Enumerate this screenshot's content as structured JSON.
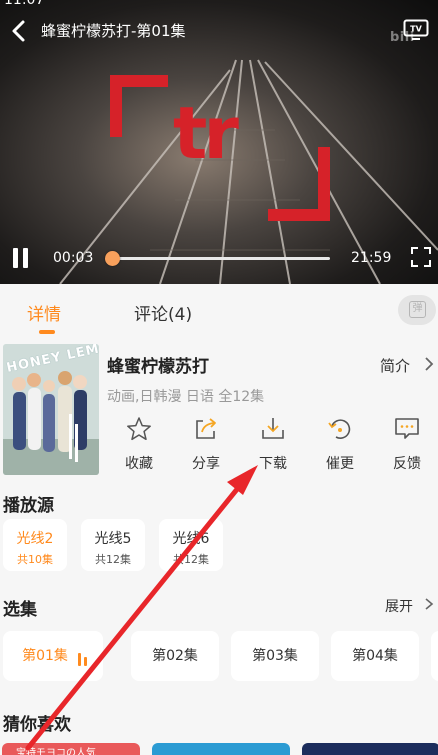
{
  "status_bar": {
    "time": "11:07"
  },
  "player": {
    "title": "蜂蜜柠檬苏打-第01集",
    "watermark": "bili",
    "logo_text": "tr",
    "elapsed": "00:03",
    "duration": "21:59",
    "progress": 0.003,
    "icons": {
      "back": "back-arrow-icon",
      "cast": "tv-cast-icon",
      "pause": "pause-icon",
      "fullscreen": "fullscreen-icon"
    }
  },
  "tabs": [
    {
      "label": "详情",
      "active": true
    },
    {
      "label": "评论(4)",
      "active": false
    }
  ],
  "danmaku": {
    "glyph": "弹",
    "icon": "danmaku-toggle-icon"
  },
  "show": {
    "poster_text": "HONEY LEMON Soda",
    "title": "蜂蜜柠檬苏打",
    "meta": "动画,日韩漫 日语 全12集",
    "intro_label": "简介"
  },
  "actions": [
    {
      "label": "收藏",
      "icon": "star-icon"
    },
    {
      "label": "分享",
      "icon": "share-icon"
    },
    {
      "label": "下载",
      "icon": "download-icon"
    },
    {
      "label": "催更",
      "icon": "refresh-icon"
    },
    {
      "label": "反馈",
      "icon": "feedback-icon"
    }
  ],
  "sources": {
    "title": "播放源",
    "items": [
      {
        "name": "光线2",
        "count": "共10集",
        "active": true
      },
      {
        "name": "光线5",
        "count": "共12集",
        "active": false
      },
      {
        "name": "光线6",
        "count": "共12集",
        "active": false
      }
    ]
  },
  "episodes": {
    "title": "选集",
    "expand_label": "展开",
    "items": [
      {
        "name": "第01集",
        "active": true
      },
      {
        "name": "第02集",
        "active": false
      },
      {
        "name": "第03集",
        "active": false
      },
      {
        "name": "第04集",
        "active": false
      }
    ]
  },
  "recommend": {
    "title": "猜你喜欢",
    "items": [
      {
        "caption": "宝特モヨコの人気",
        "color": "#e9595a"
      },
      {
        "caption": "",
        "color": "#2b9bd3"
      },
      {
        "caption": "",
        "color": "#1c2d5c"
      }
    ]
  },
  "colors": {
    "accent": "#ff8a1e",
    "annotation_arrow": "#e8262a",
    "logo_red": "#d62229"
  }
}
